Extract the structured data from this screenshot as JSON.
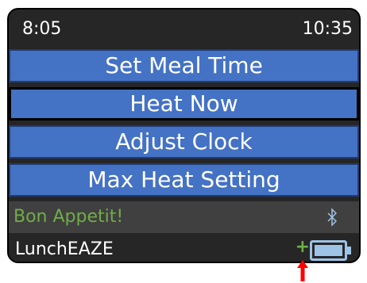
{
  "status_bar": {
    "left_time": "8:05",
    "right_time": "10:35"
  },
  "menu": {
    "items": [
      {
        "label": "Set Meal Time"
      },
      {
        "label": "Heat Now"
      },
      {
        "label": "Adjust Clock"
      },
      {
        "label": "Max Heat Setting"
      }
    ],
    "selected_index": 1
  },
  "footer": {
    "greeting": "Bon Appetit!",
    "app_name": "LunchEAZE",
    "charge_indicator": "+",
    "icons": [
      "bluetooth-icon",
      "battery-icon",
      "red-arrow-icon"
    ]
  },
  "colors": {
    "menu_bg": "#4472c4",
    "screen_bg": "#262626",
    "greeting_bg": "#404040",
    "greeting_text": "#70ad47",
    "bluetooth": "#9dc3e6",
    "battery_fill": "#9dc3e6",
    "arrow": "#ff0000"
  }
}
